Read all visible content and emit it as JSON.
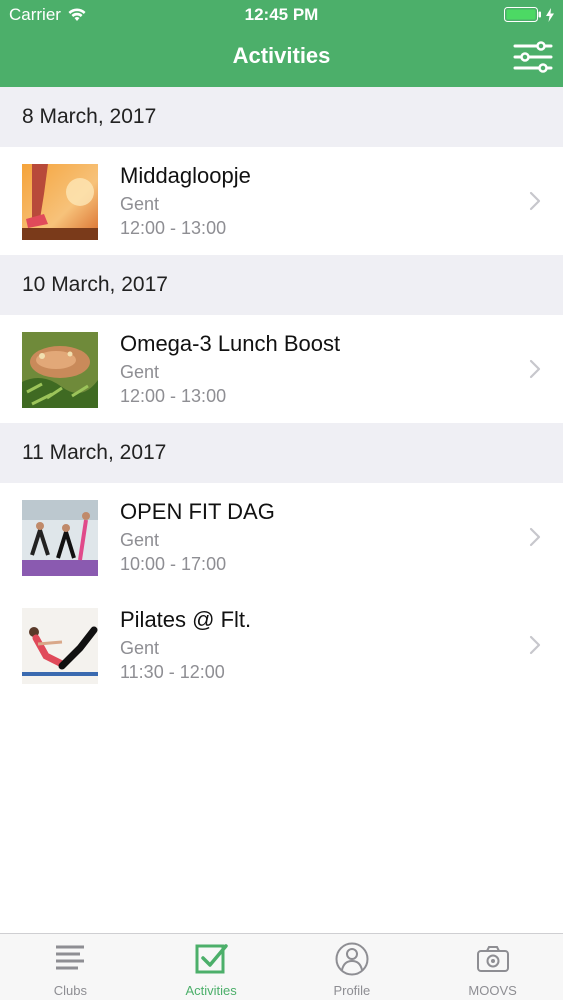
{
  "status_bar": {
    "carrier": "Carrier",
    "time": "12:45 PM"
  },
  "nav": {
    "title": "Activities",
    "filter_icon": "sliders-icon"
  },
  "sections": [
    {
      "date": "8 March, 2017",
      "items": [
        {
          "title": "Middagloopje",
          "location": "Gent",
          "time": "12:00 - 13:00",
          "image": "runner-sunset"
        }
      ]
    },
    {
      "date": "10 March, 2017",
      "items": [
        {
          "title": "Omega-3 Lunch Boost",
          "location": "Gent",
          "time": "12:00 - 13:00",
          "image": "salmon-salad"
        }
      ]
    },
    {
      "date": "11 March, 2017",
      "items": [
        {
          "title": "OPEN FIT DAG",
          "location": "Gent",
          "time": "10:00 - 17:00",
          "image": "fitness-class"
        },
        {
          "title": "Pilates @ Flt.",
          "location": "Gent",
          "time": "11:30 - 12:00",
          "image": "pilates-pose"
        }
      ]
    }
  ],
  "tabs": [
    {
      "label": "Clubs",
      "icon": "list-icon",
      "active": false
    },
    {
      "label": "Activities",
      "icon": "checkbox-icon",
      "active": true
    },
    {
      "label": "Profile",
      "icon": "person-icon",
      "active": false
    },
    {
      "label": "MOOVS",
      "icon": "camera-icon",
      "active": false
    }
  ],
  "colors": {
    "accent": "#4caf6a",
    "section_bg": "#efeff4",
    "secondary_text": "#8e8e93"
  }
}
